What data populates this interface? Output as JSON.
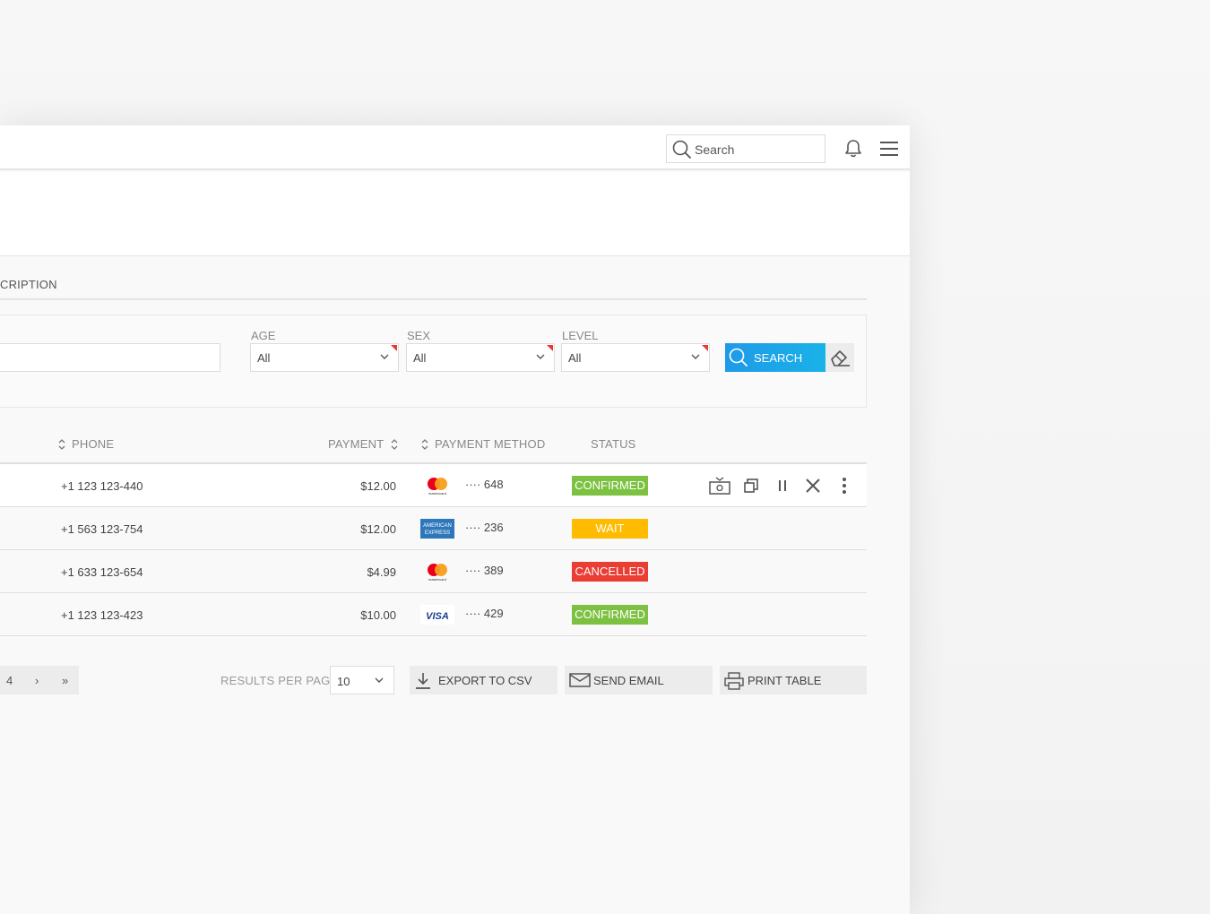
{
  "topbar": {
    "search_placeholder": "Search",
    "icons": [
      "search-icon",
      "bell-icon",
      "menu-icon"
    ]
  },
  "section": {
    "label": "CRIPTION"
  },
  "filters": {
    "age": {
      "label": "AGE",
      "value": "All"
    },
    "sex": {
      "label": "SEX",
      "value": "All"
    },
    "level": {
      "label": "LEVEL",
      "value": "All"
    },
    "search_button": "SEARCH",
    "clear_icon": "eraser-icon"
  },
  "table": {
    "headers": {
      "phone": "PHONE",
      "payment": "PAYMENT",
      "payment_method": "PAYMENT METHOD",
      "status": "STATUS"
    },
    "rows": [
      {
        "phone": "+1 123 123-440",
        "payment": "$12.00",
        "card": "mastercard",
        "last4": "···· 648",
        "status": "CONFIRMED",
        "status_color": "#7dc142"
      },
      {
        "phone": "+1 563 123-754",
        "payment": "$12.00",
        "card": "amex",
        "last4": "···· 236",
        "status": "WAIT",
        "status_color": "#ffbb00"
      },
      {
        "phone": "+1 633 123-654",
        "payment": "$4.99",
        "card": "mastercard",
        "last4": "···· 389",
        "status": "CANCELLED",
        "status_color": "#ea3d34"
      },
      {
        "phone": "+1 123 123-423",
        "payment": "$10.00",
        "card": "visa",
        "last4": "···· 429",
        "status": "CONFIRMED",
        "status_color": "#7dc142"
      }
    ],
    "row_actions": [
      "refund-icon",
      "copy-icon",
      "pause-icon",
      "close-icon",
      "more-vertical-icon"
    ]
  },
  "footer": {
    "pager": {
      "page": "4",
      "next": "›",
      "last": "»"
    },
    "results_per_page_label": "RESULTS PER PAGE",
    "results_per_page_value": "10",
    "export_csv": "EXPORT TO CSV",
    "send_email": "SEND EMAIL",
    "print_table": "PRINT TABLE"
  },
  "card_labels": {
    "amex_line1": "AMERICAN",
    "amex_line2": "EXPRESS",
    "visa": "VISA",
    "mastercard": "mastercard"
  }
}
